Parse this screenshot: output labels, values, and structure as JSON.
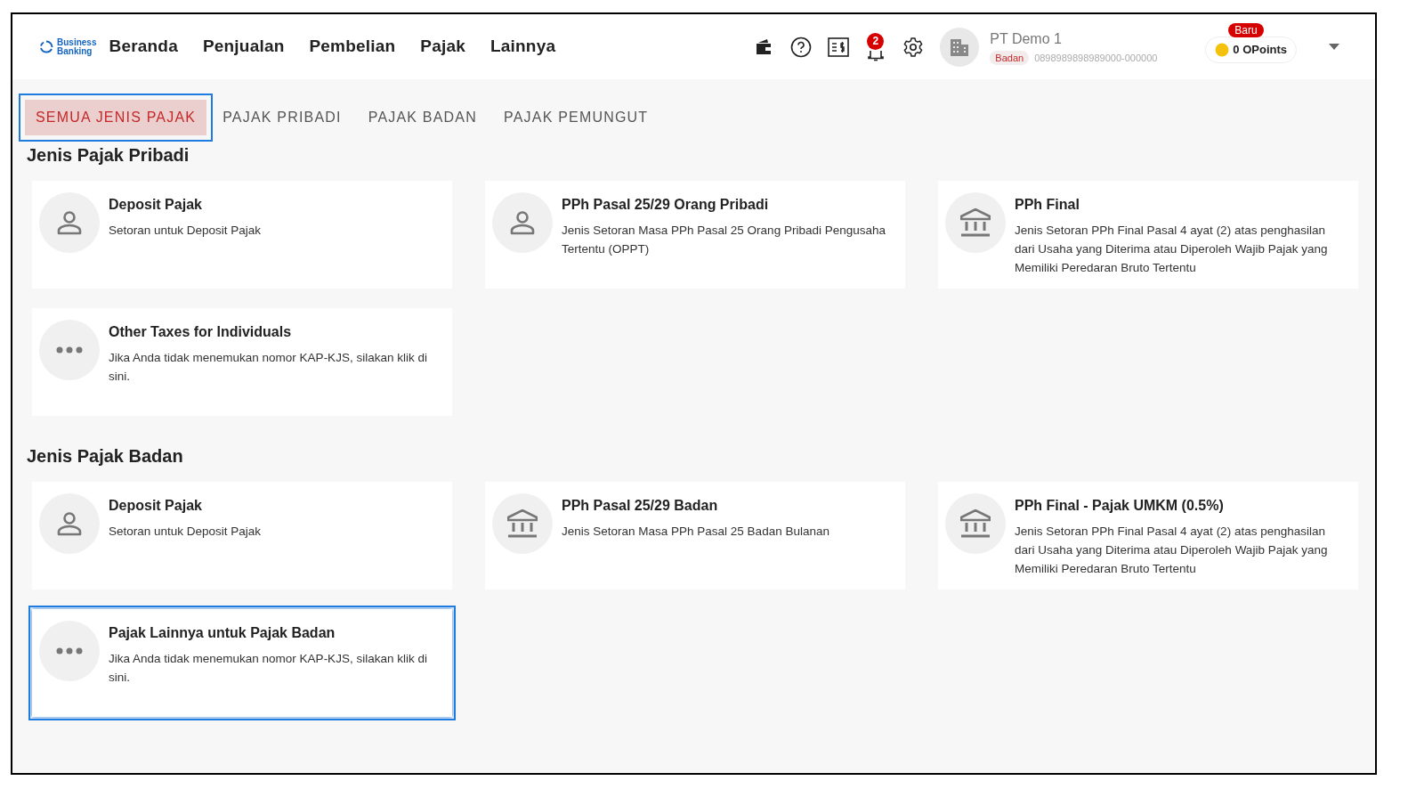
{
  "header": {
    "logo": [
      "Business",
      "Banking"
    ],
    "nav": [
      {
        "label": "Beranda"
      },
      {
        "label": "Penjualan"
      },
      {
        "label": "Pembelian"
      },
      {
        "label": "Pajak"
      },
      {
        "label": "Lainnya"
      }
    ],
    "notification_count": "2",
    "company": {
      "name": "PT Demo 1",
      "type": "Badan",
      "npwp": "0898989898989000-000000"
    },
    "points": {
      "badge": "Baru",
      "label": "0 OPoints"
    }
  },
  "tabs": [
    {
      "label": "SEMUA JENIS PAJAK",
      "selected": true,
      "highlighted": true
    },
    {
      "label": "PAJAK PRIBADI",
      "selected": false,
      "highlighted": false
    },
    {
      "label": "PAJAK BADAN",
      "selected": false,
      "highlighted": false
    },
    {
      "label": "PAJAK PEMUNGUT",
      "selected": false,
      "highlighted": false
    }
  ],
  "sections": [
    {
      "title": "Jenis Pajak Pribadi",
      "cards": [
        {
          "kind": "person",
          "title": "Deposit Pajak",
          "description": "Setoran untuk Deposit Pajak",
          "highlighted": false
        },
        {
          "kind": "person",
          "title": "PPh Pasal 25/29 Orang Pribadi",
          "description": "Jenis Setoran Masa PPh Pasal 25 Orang Pribadi Pengusaha Tertentu (OPPT)",
          "highlighted": false
        },
        {
          "kind": "bank",
          "title": "PPh Final",
          "description": "Jenis Setoran PPh Final Pasal 4 ayat (2) atas penghasilan dari Usaha yang Diterima atau Diperoleh Wajib Pajak yang Memiliki Peredaran Bruto Tertentu",
          "highlighted": false
        },
        {
          "kind": "more",
          "title": "Other Taxes for Individuals",
          "description": "Jika Anda tidak menemukan nomor KAP-KJS, silakan klik di sini.",
          "highlighted": false
        }
      ]
    },
    {
      "title": "Jenis Pajak Badan",
      "cards": [
        {
          "kind": "person",
          "title": "Deposit Pajak",
          "description": "Setoran untuk Deposit Pajak",
          "highlighted": false
        },
        {
          "kind": "bank",
          "title": "PPh Pasal 25/29 Badan",
          "description": "Jenis Setoran Masa PPh Pasal 25 Badan Bulanan",
          "highlighted": false
        },
        {
          "kind": "bank",
          "title": "PPh Final - Pajak UMKM (0.5%)",
          "description": "Jenis Setoran PPh Final Pasal 4 ayat (2) atas penghasilan dari Usaha yang Diterima atau Diperoleh Wajib Pajak yang Memiliki Peredaran Bruto Tertentu",
          "highlighted": false
        },
        {
          "kind": "more",
          "title": "Pajak Lainnya untuk Pajak Badan",
          "description": "Jika Anda tidak menemukan nomor KAP-KJS, silakan klik di sini.",
          "highlighted": true
        }
      ]
    }
  ]
}
